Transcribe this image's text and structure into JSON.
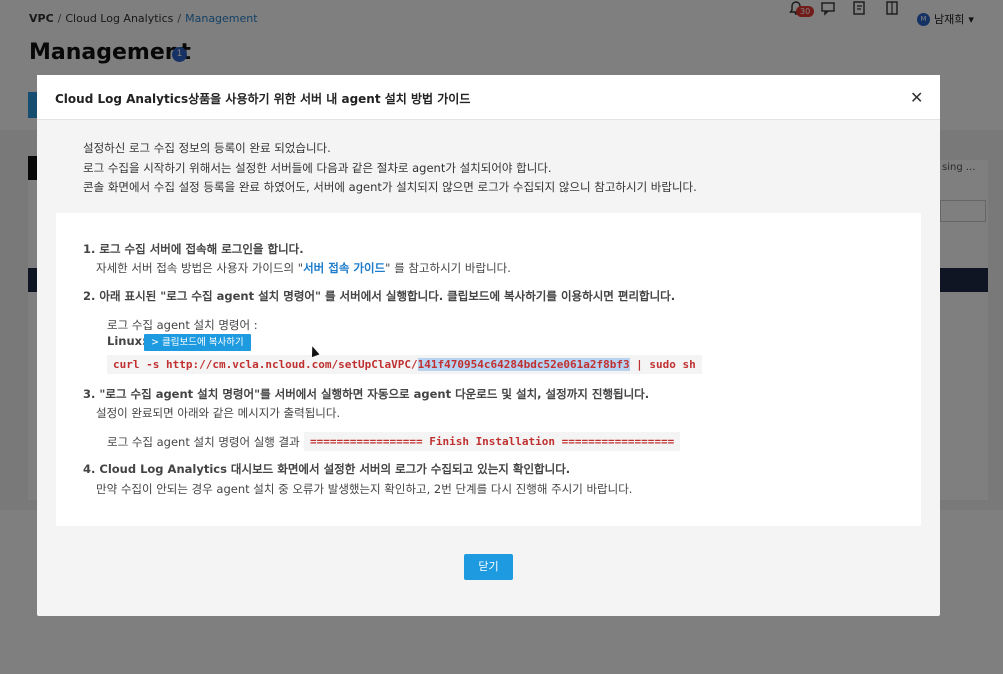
{
  "breadcrumb": {
    "items": [
      "VPC",
      "Cloud Log Analytics",
      "Management"
    ]
  },
  "header": {
    "notification_count": "30",
    "user_initial": "M",
    "user_name": "남재희"
  },
  "page": {
    "title": "Management",
    "title_badge": "1"
  },
  "background": {
    "select_text": "sing ..."
  },
  "modal": {
    "title": "Cloud Log Analytics상품을 사용하기 위한 서버 내 agent 설치 방법 가이드",
    "intro": [
      "설정하신 로그 수집 정보의 등록이 완료 되었습니다.",
      "로그 수집을 시작하기 위해서는 설정한 서버들에 다음과 같은 절차로 agent가 설치되어야 합니다.",
      "콘솔 화면에서 수집 설정 등록을 완료 하였어도, 서버에 agent가 설치되지 않으면 로그가 수집되지 않으니 참고하시기 바랍니다."
    ],
    "step1": "1. 로그 수집 서버에 접속해 로그인을 합니다.",
    "step1_sub_pre": "자세한 서버 접속 방법은 사용자 가이드의 \"",
    "step1_link": "서버 접속 가이드",
    "step1_sub_post": "\" 를 참고하시기 바랍니다.",
    "step2": "2. 아래 표시된 \"로그 수집 agent 설치 명령어\" 를 서버에서 실행합니다. 클립보드에 복사하기를 이용하시면 편리합니다.",
    "install_cmd_label": "로그 수집 agent 설치 명령어 :",
    "linux_label": "Linux:",
    "copy_button": "> 클립보드에 복사하기",
    "cmd_pre": "curl -s http://cm.vcla.ncloud.com/setUpClaVPC/",
    "cmd_key": "141f470954c64284bdc52e061a2f8bf3",
    "cmd_post": " | sudo sh",
    "step3": "3. \"로그 수집 agent 설치 명령어\"를 서버에서 실행하면 자동으로 agent 다운로드 및 설치, 설정까지 진행됩니다.",
    "step3_sub": "설정이 완료되면 아래와 같은 메시지가 출력됩니다.",
    "result_label": "로그 수집 agent 설치 명령어 실행 결과",
    "result_code": "================= Finish Installation =================",
    "step4": "4. Cloud Log Analytics 대시보드 화면에서 설정한 서버의 로그가 수집되고 있는지 확인합니다.",
    "step4_sub": "만약 수집이 안되는 경우 agent 설치 중 오류가 발생했는지 확인하고, 2번 단계를 다시 진행해 주시기 바랍니다.",
    "close_button": "닫기"
  }
}
